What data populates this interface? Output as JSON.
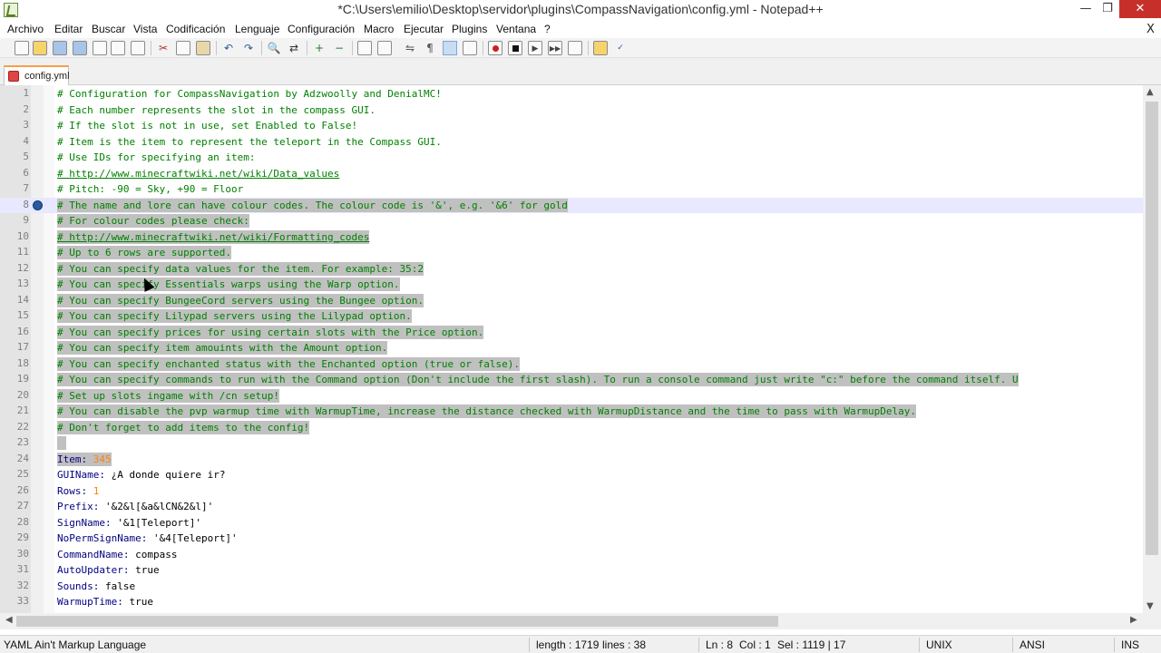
{
  "window": {
    "title": "*C:\\Users\\emilio\\Desktop\\servidor\\plugins\\CompassNavigation\\config.yml - Notepad++",
    "min_glyph": "—",
    "max_glyph": "❐",
    "close_glyph": "✕"
  },
  "menu": {
    "items": [
      "Archivo",
      "Editar",
      "Buscar",
      "Vista",
      "Codificación",
      "Lenguaje",
      "Configuración",
      "Macro",
      "Ejecutar",
      "Plugins",
      "Ventana",
      "?"
    ],
    "close_doc": "X"
  },
  "tabs": [
    {
      "label": "config.yml"
    }
  ],
  "lines": [
    {
      "n": "1",
      "text": "# Configuration for CompassNavigation by Adzwoolly and DenialMC!"
    },
    {
      "n": "2",
      "text": "# Each number represents the slot in the compass GUI."
    },
    {
      "n": "3",
      "text": "# If the slot is not in use, set Enabled to False!"
    },
    {
      "n": "4",
      "text": "# Item is the item to represent the teleport in the Compass GUI."
    },
    {
      "n": "5",
      "text": "# Use IDs for specifying an item:"
    },
    {
      "n": "6",
      "text": "# http://www.minecraftwiki.net/wiki/Data_values"
    },
    {
      "n": "7",
      "text": "# Pitch: -90 = Sky, +90 = Floor"
    },
    {
      "n": "8",
      "text": "# The name and lore can have colour codes. The colour code is '&', e.g. '&6' for gold"
    },
    {
      "n": "9",
      "text": "# For colour codes please check:"
    },
    {
      "n": "10",
      "text": "# http://www.minecraftwiki.net/wiki/Formatting_codes"
    },
    {
      "n": "11",
      "text": "# Up to 6 rows are supported."
    },
    {
      "n": "12",
      "text": "# You can specify data values for the item. For example: 35:2"
    },
    {
      "n": "13",
      "text": "# You can specify Essentials warps using the Warp option."
    },
    {
      "n": "14",
      "text": "# You can specify BungeeCord servers using the Bungee option."
    },
    {
      "n": "15",
      "text": "# You can specify Lilypad servers using the Lilypad option."
    },
    {
      "n": "16",
      "text": "# You can specify prices for using certain slots with the Price option."
    },
    {
      "n": "17",
      "text": "# You can specify item amouints with the Amount option."
    },
    {
      "n": "18",
      "text": "# You can specify enchanted status with the Enchanted option (true or false)."
    },
    {
      "n": "19",
      "text": "# You can specify commands to run with the Command option (Don't include the first slash). To run a console command just write \"c:\" before the command itself. U"
    },
    {
      "n": "20",
      "text": "# Set up slots ingame with /cn setup!"
    },
    {
      "n": "21",
      "text": "# You can disable the pvp warmup time with WarmupTime, increase the distance checked with WarmupDistance and the time to pass with WarmupDelay."
    },
    {
      "n": "22",
      "text": "# Don't forget to add items to the config!"
    },
    {
      "n": "23",
      "text": ""
    },
    {
      "n": "24",
      "key": "Item:",
      "val": " 345"
    },
    {
      "n": "25",
      "key": "GUIName:",
      "val": " ¿A donde quiere ir?"
    },
    {
      "n": "26",
      "key": "Rows:",
      "val": " 1"
    },
    {
      "n": "27",
      "key": "Prefix:",
      "val": " '&2&l[&a&lCN&2&l]'"
    },
    {
      "n": "28",
      "key": "SignName:",
      "val": " '&1[Teleport]'"
    },
    {
      "n": "29",
      "key": "NoPermSignName:",
      "val": " '&4[Teleport]'"
    },
    {
      "n": "30",
      "key": "CommandName:",
      "val": " compass"
    },
    {
      "n": "31",
      "key": "AutoUpdater:",
      "val": " true"
    },
    {
      "n": "32",
      "key": "Sounds:",
      "val": " false"
    },
    {
      "n": "33",
      "key": "WarmupTime:",
      "val": " true"
    }
  ],
  "status": {
    "language": "YAML Ain't Markup Language",
    "length": "length : 1719",
    "lines": "lines : 38",
    "ln": "Ln : 8",
    "col": "Col : 1",
    "sel": "Sel : 1119 | 17",
    "eol": "UNIX",
    "encoding": "ANSI",
    "mode": "INS"
  }
}
